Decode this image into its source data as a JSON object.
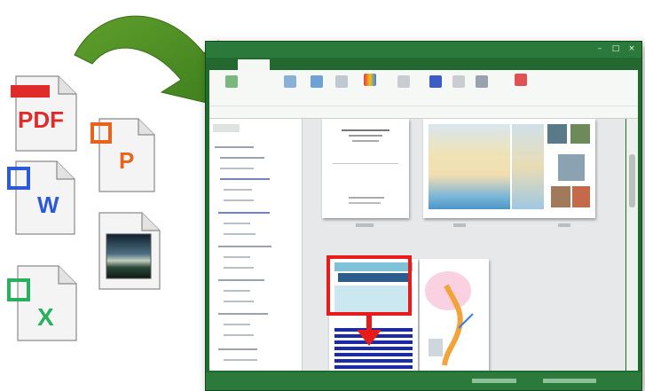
{
  "files": [
    {
      "type": "PDF",
      "label": "PDF",
      "accent": "#e02b2b",
      "icon": "pdf-file-icon"
    },
    {
      "type": "PowerPoint",
      "label": "P",
      "accent": "#e8641c",
      "icon": "powerpoint-file-icon"
    },
    {
      "type": "Word",
      "label": "W",
      "accent": "#2a5ad8",
      "icon": "word-file-icon"
    },
    {
      "type": "Image",
      "label": "",
      "accent": "#2b4a5e",
      "icon": "image-file-icon"
    },
    {
      "type": "Excel",
      "label": "X",
      "accent": "#28b05c",
      "icon": "excel-file-icon"
    }
  ],
  "colors": {
    "arrow": "#5f9e2b",
    "window_frame": "#1e6d2f",
    "highlight": "#e81b1b"
  }
}
